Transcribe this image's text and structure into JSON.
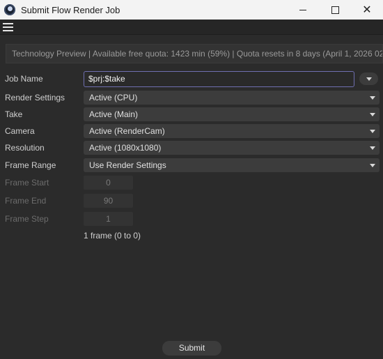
{
  "window": {
    "title": "Submit Flow Render Job",
    "app_icon": "cinema4d-icon",
    "controls": {
      "minimize": "minimize-icon",
      "maximize": "maximize-icon",
      "close": "✕"
    }
  },
  "menubar": {
    "menu_icon": "hamburger-icon"
  },
  "info": {
    "text": "Technology Preview | Available free quota: 1423 min (59%) | Quota resets in 8 days (April  1, 2026 02..."
  },
  "form": {
    "job_name": {
      "label": "Job Name",
      "value": "$prj:$take"
    },
    "render_settings": {
      "label": "Render Settings",
      "value": "Active (CPU)"
    },
    "take": {
      "label": "Take",
      "value": "Active (Main)"
    },
    "camera": {
      "label": "Camera",
      "value": "Active (RenderCam)"
    },
    "resolution": {
      "label": "Resolution",
      "value": "Active (1080x1080)"
    },
    "frame_range": {
      "label": "Frame Range",
      "value": "Use Render Settings"
    },
    "frame_start": {
      "label": "Frame Start",
      "value": "0"
    },
    "frame_end": {
      "label": "Frame End",
      "value": "90"
    },
    "frame_step": {
      "label": "Frame Step",
      "value": "1"
    },
    "frame_summary": "1 frame (0 to 0)"
  },
  "actions": {
    "submit_label": "Submit"
  },
  "colors": {
    "accent_border": "#6f6fb0",
    "background": "#2b2b2b",
    "field": "#3c3c3c"
  }
}
